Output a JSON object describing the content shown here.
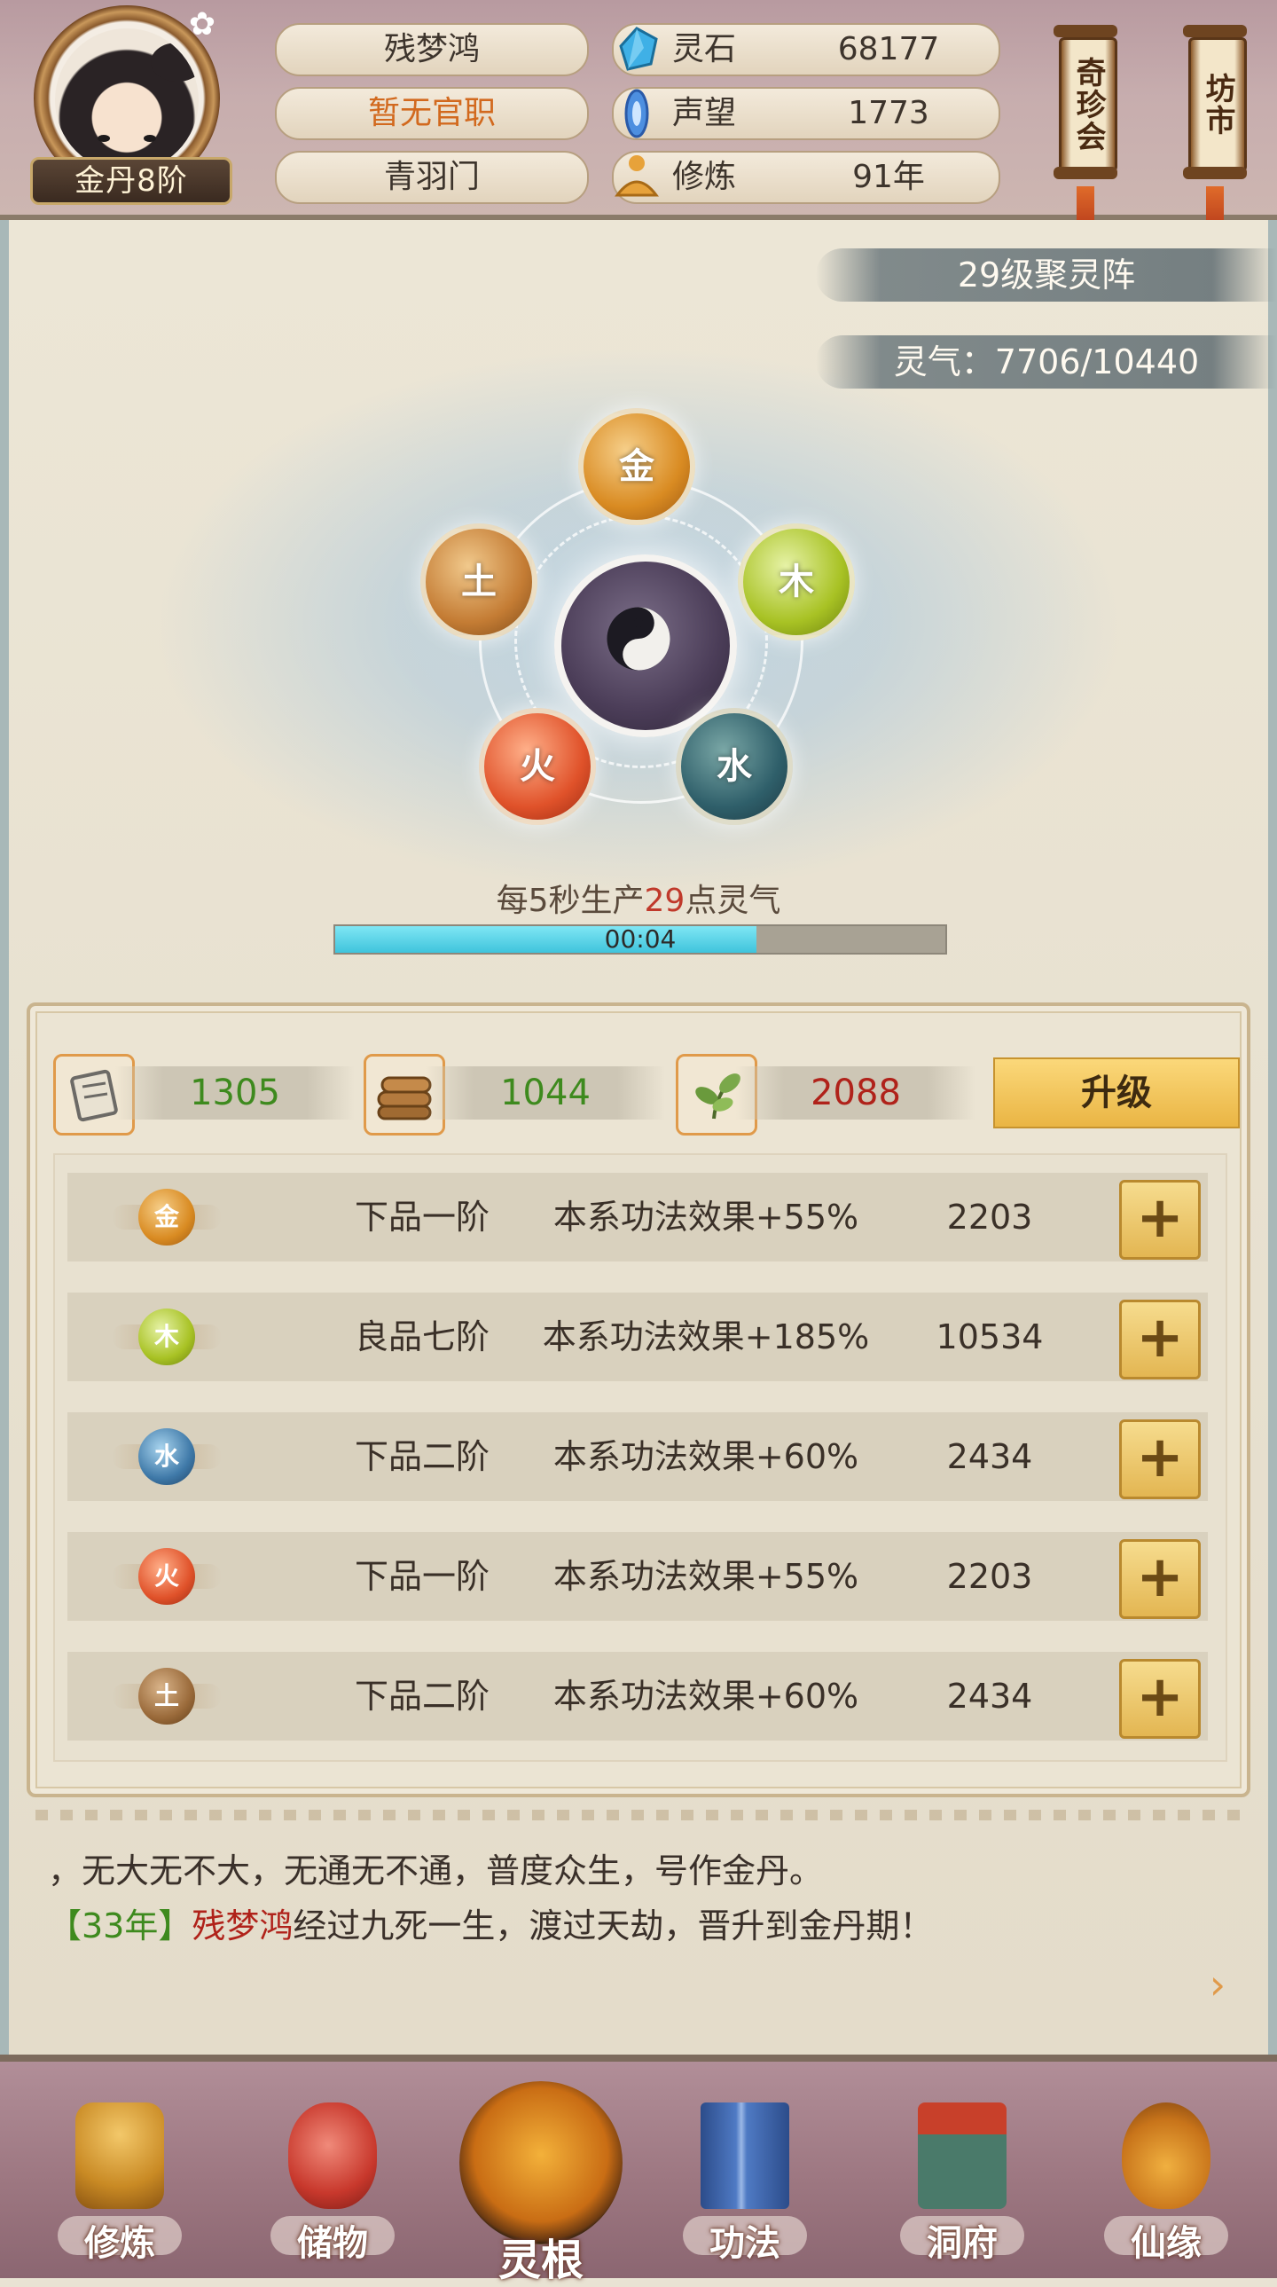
{
  "header": {
    "rank": "金丹8阶",
    "name": "残梦鸿",
    "official_title": "暂无官职",
    "sect": "青羽门",
    "resources": [
      {
        "label": "灵石",
        "value": "68177",
        "icon": "spirit-stone-icon"
      },
      {
        "label": "声望",
        "value": "1773",
        "icon": "reputation-icon"
      },
      {
        "label": "修炼",
        "value": "91年",
        "icon": "meditation-icon"
      }
    ],
    "side_buttons": [
      {
        "label": "奇珍会"
      },
      {
        "label": "坊市"
      }
    ]
  },
  "array": {
    "level_title": "29级聚灵阵",
    "qi_status": "灵气：7706/10440",
    "elements": {
      "metal": "金",
      "wood": "木",
      "water": "水",
      "fire": "火",
      "earth": "土"
    },
    "production": {
      "prefix": "每5秒生产",
      "amount": "29",
      "suffix": "点灵气"
    },
    "timer": "00:04",
    "timer_progress": 0.69
  },
  "materials": [
    {
      "icon": "scroll-material-icon",
      "value": "1305",
      "color": "green"
    },
    {
      "icon": "wood-logs-icon",
      "value": "1044",
      "color": "green"
    },
    {
      "icon": "herb-leaf-icon",
      "value": "2088",
      "color": "red"
    }
  ],
  "upgrade_label": "升级",
  "element_rows": [
    {
      "element": "金",
      "grade": "下品一阶",
      "effect": "本系功法效果+55%",
      "cost": "2203",
      "color": "#d9912e"
    },
    {
      "element": "木",
      "grade": "良品七阶",
      "effect": "本系功法效果+185%",
      "cost": "10534",
      "color": "#9cb82a"
    },
    {
      "element": "水",
      "grade": "下品二阶",
      "effect": "本系功法效果+60%",
      "cost": "2434",
      "color": "#3f79a8"
    },
    {
      "element": "火",
      "grade": "下品一阶",
      "effect": "本系功法效果+55%",
      "cost": "2203",
      "color": "#d9472a"
    },
    {
      "element": "土",
      "grade": "下品二阶",
      "effect": "本系功法效果+60%",
      "cost": "2434",
      "color": "#9a6a3a"
    }
  ],
  "plus_label": "+",
  "log": {
    "line1": "，无大无不大，无通无不通，普度众生，号作金丹。",
    "line2_year": "【33年】",
    "line2_name": "残梦鸿",
    "line2_text": "经过九死一生，渡过天劫，晋升到金丹期！",
    "next_arrow": "›"
  },
  "nav": [
    {
      "label": "修炼",
      "icon": "cultivator-icon"
    },
    {
      "label": "储物",
      "icon": "storage-bag-icon"
    },
    {
      "label": "灵根",
      "icon": "spirit-root-icon"
    },
    {
      "label": "功法",
      "icon": "technique-book-icon"
    },
    {
      "label": "洞府",
      "icon": "cave-abode-icon"
    },
    {
      "label": "仙缘",
      "icon": "immortal-fate-icon"
    }
  ]
}
